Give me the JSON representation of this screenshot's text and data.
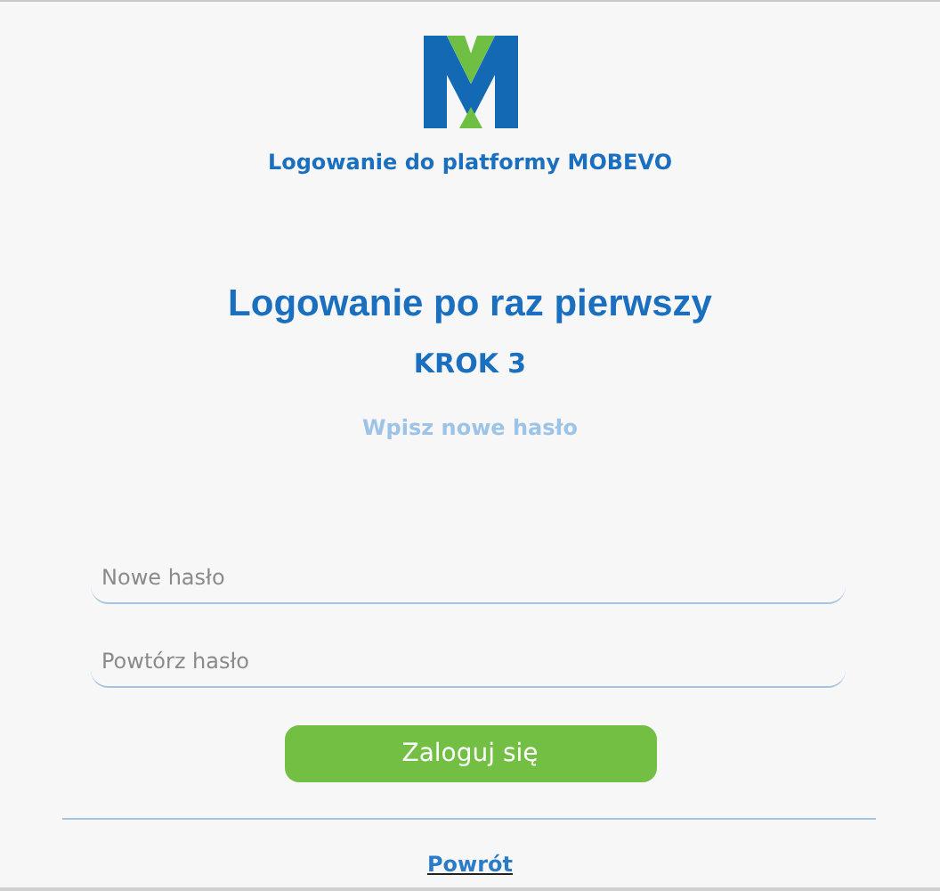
{
  "header": {
    "subtitle": "Logowanie do platformy MOBEVO"
  },
  "title": "Logowanie po raz pierwszy",
  "step": "KROK 3",
  "instruction": "Wpisz nowe hasło",
  "fields": [
    {
      "placeholder": "Nowe hasło"
    },
    {
      "placeholder": "Powtórz hasło"
    }
  ],
  "submit": "Zaloguj się",
  "back_link": "Powrót"
}
